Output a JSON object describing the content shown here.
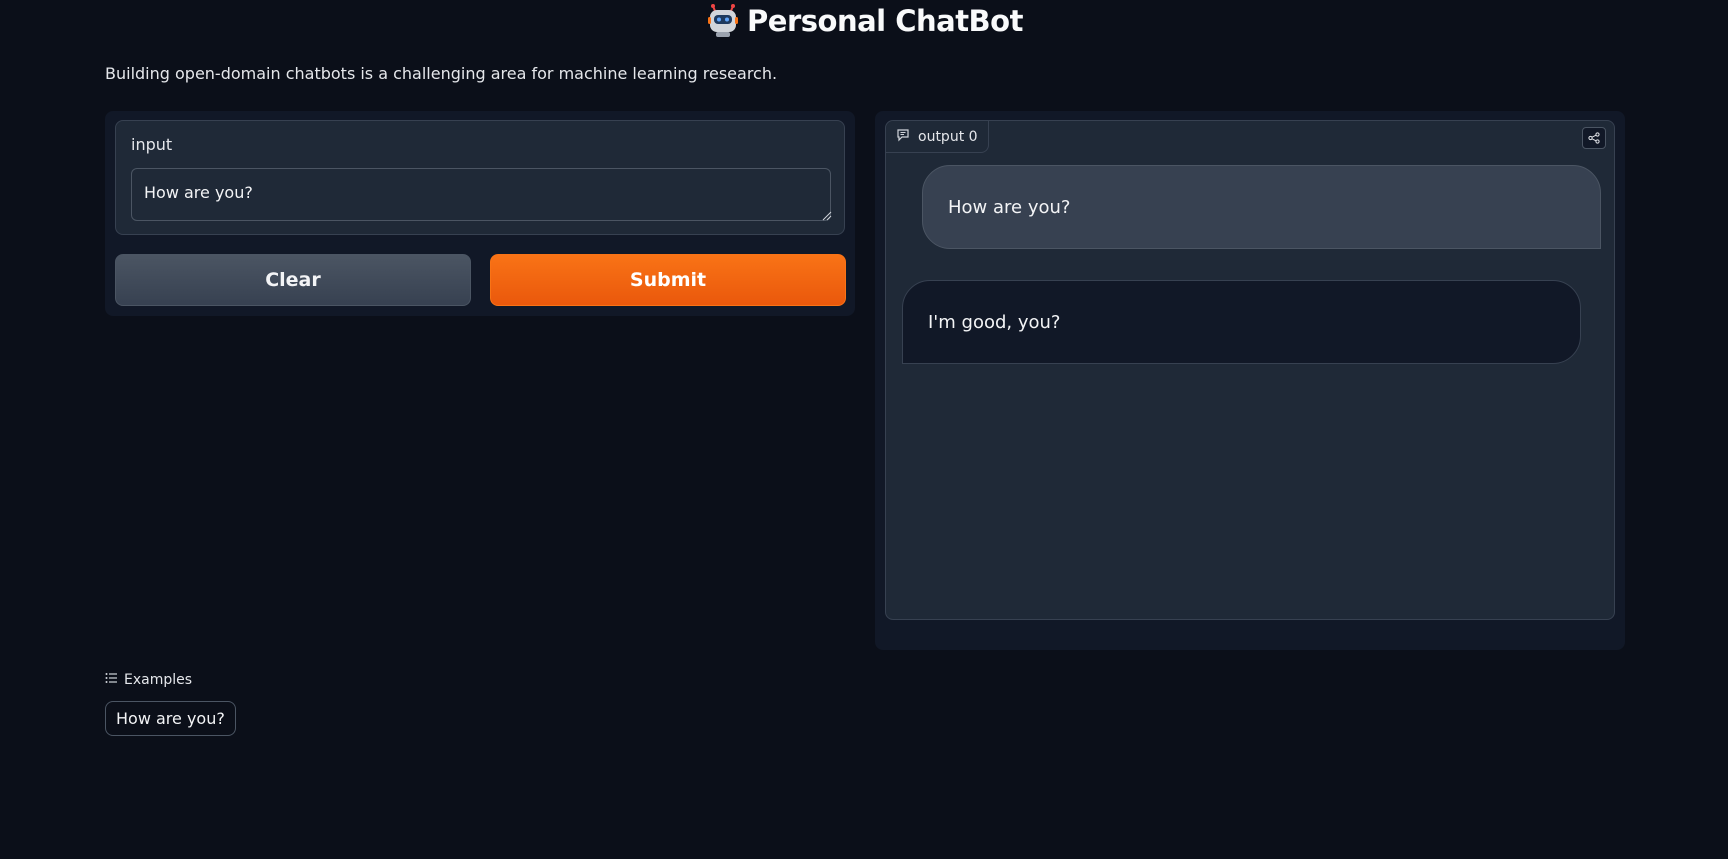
{
  "header": {
    "title": "Personal ChatBot",
    "icon": "robot-emoji-icon"
  },
  "description": "Building open-domain chatbots is a challenging area for machine learning research.",
  "input": {
    "label": "input",
    "value": "How are you?"
  },
  "buttons": {
    "clear_label": "Clear",
    "submit_label": "Submit"
  },
  "output": {
    "tab_label": "output 0",
    "tab_icon": "chat-icon",
    "share_icon": "share-icon",
    "messages": [
      {
        "role": "user",
        "text": "How are you?"
      },
      {
        "role": "bot",
        "text": "I'm good, you?"
      }
    ]
  },
  "examples": {
    "header_label": "Examples",
    "header_icon": "list-icon",
    "items": [
      "How are you?"
    ]
  },
  "colors": {
    "background": "#0b0f19",
    "panel": "#111827",
    "block": "#1f2937",
    "accent": "#f97316",
    "secondary_button": "#4b5563"
  }
}
